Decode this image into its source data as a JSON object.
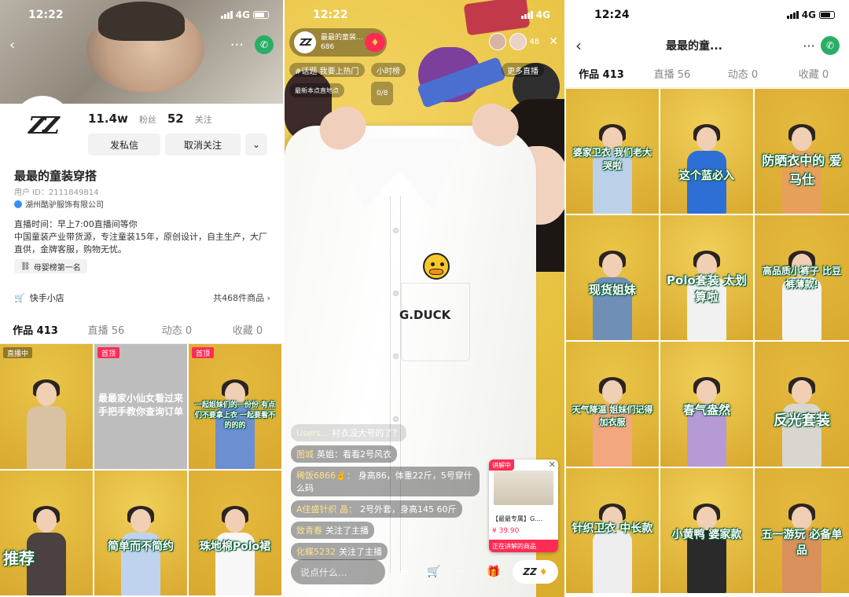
{
  "panels": {
    "profile": {
      "status": {
        "time": "12:22",
        "network": "4G"
      },
      "followers_value": "11.4w",
      "followers_label": "粉丝",
      "following_value": "52",
      "following_label": "关注",
      "btn_message": "发私信",
      "btn_unfollow": "取消关注",
      "btn_more": "⌄",
      "avatar_text": "ZZ",
      "name": "最最的童装穿搭",
      "user_id": "用户 ID：2111849814",
      "company": "湖州酷驴服饰有限公司",
      "bio_lines": [
        "直播时间：早上7:00直播间等你",
        "中国童装产业带货源，专注童装15年，原创设计，自主生产，大厂直供，金牌客服，购物无忧。"
      ],
      "tag": "母婴榜第一名",
      "shop_label": "快手小店",
      "shop_count": "共468件商品",
      "tabs": [
        "作品 413",
        "直播 56",
        "动态 0",
        "收藏 0"
      ],
      "grid": [
        {
          "badge": "直播中",
          "caption": "",
          "shirt": "#d9c2a3"
        },
        {
          "badge": "首顶",
          "caption": "最最家小仙女看过来 手把手教你查询订单",
          "shirt": ""
        },
        {
          "badge": "首顶",
          "caption": "一起姐妹们的一份份 有点们不要拿上衣 一起要看不 的的的",
          "shirt": "#6b8fd0"
        },
        {
          "badge": "",
          "caption": "推荐",
          "shirt": "#4a4140"
        },
        {
          "badge": "",
          "caption": "简单而不简约",
          "shirt": "#bfd3ef"
        },
        {
          "badge": "",
          "caption": "珠地棉Polo裙",
          "shirt": "#f7f7f7"
        }
      ]
    },
    "live": {
      "status": {
        "time": "12:22",
        "network": "4G"
      },
      "host_name": "最最的童装...",
      "host_likes": "686",
      "avatar_text": "ZZ",
      "viewer_count": "48",
      "chips": [
        "#话题 我要上热门",
        "小时榜",
        "更多直播"
      ],
      "topic_small": "最新本点直地点",
      "timer": "0/8",
      "logo": "G.DUCK",
      "comments": [
        {
          "user": "Users...",
          "text": "衬衣没大号的了？",
          "faint": true
        },
        {
          "user": "图城",
          "text": "英姐：看看2号风衣",
          "faint": false
        },
        {
          "user": "稀饭6866✌️：",
          "text": "身高86，体重22斤，5号穿什么码",
          "faint": false
        },
        {
          "user": "A佳盛针织 晶：",
          "text": "2号外套，身高145 60斤",
          "faint": false
        },
        {
          "user": "致青春",
          "text": "关注了主播",
          "faint": false
        },
        {
          "user": "化蝶5232",
          "text": "关注了主播",
          "faint": false
        }
      ],
      "product": {
        "tag": "讲解中",
        "name": "【最最专属】G....",
        "price": "¥ 39.90",
        "label": "正在讲解的商品"
      },
      "input_placeholder": "说点什么..."
    },
    "works": {
      "status": {
        "time": "12:24",
        "network": "4G"
      },
      "title": "最最的童...",
      "tabs": [
        "作品 413",
        "直播 56",
        "动态 0",
        "收藏 0"
      ],
      "grid": [
        {
          "caption": "婆家卫衣 我们老大哭啦",
          "shirt": "#bcd0e8"
        },
        {
          "caption": "这个蓝必入",
          "shirt": "#2e6fd6"
        },
        {
          "caption": "防晒衣中的 爱马仕",
          "shirt": "#e7a05a"
        },
        {
          "caption": "现货姐妹",
          "shirt": "#6f8fb6"
        },
        {
          "caption": "Polo套装 太划算啦",
          "shirt": "#f1f1f1"
        },
        {
          "caption": "高品质小裤子 比豆裤薄款!",
          "shirt": "#f4f4f4"
        },
        {
          "caption": "天气降温 姐妹们记得加衣服",
          "shirt": "#f3a77e"
        },
        {
          "caption": "春气盎然",
          "shirt": "#b69ad6"
        },
        {
          "caption": "反光套装",
          "shirt": "#d9d6cf"
        },
        {
          "caption": "针织卫衣 中长款",
          "shirt": "#eeeeee"
        },
        {
          "caption": "小黄鸭 婆家款",
          "shirt": "#2a2a2a"
        },
        {
          "caption": "五一游玩 必备单品",
          "shirt": "#d9905a"
        }
      ]
    }
  },
  "colors": {
    "accent": "#fe2c55",
    "wechat": "#2aae67",
    "caption_outline": "#0a5d37",
    "bg_yellow": "#e9c548"
  }
}
